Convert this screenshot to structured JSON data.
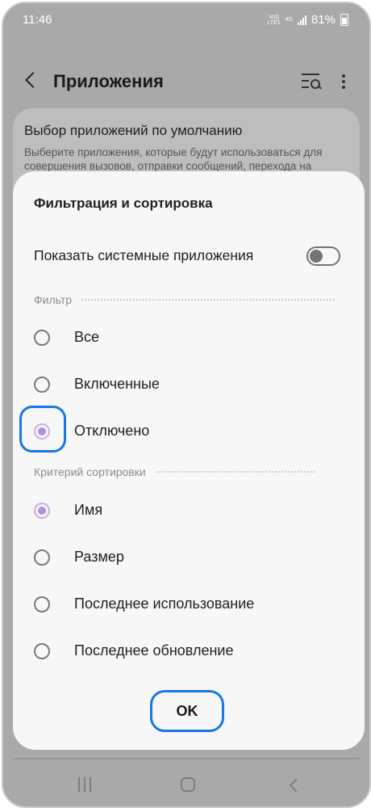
{
  "status_bar": {
    "time": "11:46",
    "volte_label": "Vo))",
    "lte_label": "LTE1",
    "network": "4G",
    "battery_percent": "81%"
  },
  "app_bar": {
    "title": "Приложения",
    "back_icon": "chevron-left-icon",
    "search_icon": "list-search-icon",
    "more_icon": "more-vertical-icon"
  },
  "background_card": {
    "title": "Выбор приложений по умолчанию",
    "description": "Выберите приложения, которые будут использоваться для совершения вызовов, отправки сообщений, перехода на"
  },
  "dialog": {
    "title": "Фильтрация и сортировка",
    "show_system_apps": {
      "label": "Показать системные приложения",
      "enabled": false
    },
    "filter": {
      "header": "Фильтр",
      "options": [
        {
          "label": "Все",
          "selected": false
        },
        {
          "label": "Включенные",
          "selected": false
        },
        {
          "label": "Отключено",
          "selected": true
        }
      ]
    },
    "sort": {
      "header": "Критерий сортировки",
      "options": [
        {
          "label": "Имя",
          "selected": true
        },
        {
          "label": "Размер",
          "selected": false
        },
        {
          "label": "Последнее использование",
          "selected": false
        },
        {
          "label": "Последнее обновление",
          "selected": false
        }
      ]
    },
    "ok_label": "OK"
  },
  "colors": {
    "accent_radio": "#b58fdc",
    "highlight_outline": "#1877e6",
    "dim_overlay": "#a9a9a9",
    "dialog_background": "#f7f7f7"
  }
}
